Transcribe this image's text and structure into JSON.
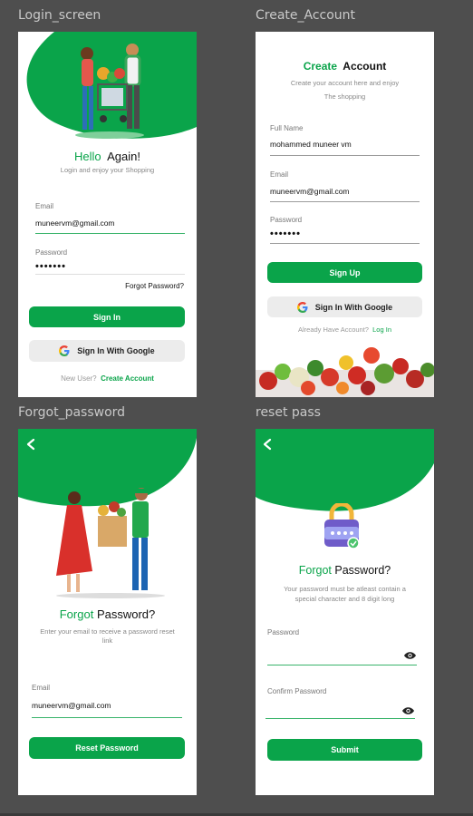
{
  "frames": {
    "login_title": "Login_screen",
    "create_title": "Create_Account",
    "forgot_title": "Forgot_password",
    "reset_title": "reset pass"
  },
  "login": {
    "hello": "Hello",
    "again": "Again!",
    "subtitle": "Login and enjoy your Shopping",
    "email_label": "Email",
    "email_value": "muneervm@gmail.com",
    "password_label": "Password",
    "password_value": "•••••••",
    "forgot_link": "Forgot Password?",
    "signin_button": "Sign In",
    "google_button": "Sign In With Google",
    "new_user": "New User?",
    "create_link": "Create Account"
  },
  "create": {
    "create": "Create",
    "account": "Account",
    "subtitle1": "Create your account  here and enjoy",
    "subtitle2": "The shopping",
    "name_label": "Full Name",
    "name_value": "mohammed muneer vm",
    "email_label": "Email",
    "email_value": "muneervm@gmail.com",
    "password_label": "Password",
    "password_value": "•••••••",
    "signup_button": "Sign Up",
    "google_button": "Sign In With Google",
    "already": "Already Have Account?",
    "login_link": "Log In"
  },
  "forgot": {
    "forgot": "Forgot",
    "password": "Password?",
    "desc": "Enter your email to receive a password reset link",
    "email_label": "Email",
    "email_value": "muneervm@gmail.com",
    "reset_button": "Reset Password"
  },
  "reset": {
    "forgot": "Forgot",
    "password": "Password?",
    "desc": "Your password must be atleast contain a special character and 8 digit long",
    "password_label": "Password",
    "confirm_label": "Confirm Password",
    "submit_button": "Submit"
  },
  "colors": {
    "accent": "#0aa44a",
    "background": "#4e4e4e"
  }
}
